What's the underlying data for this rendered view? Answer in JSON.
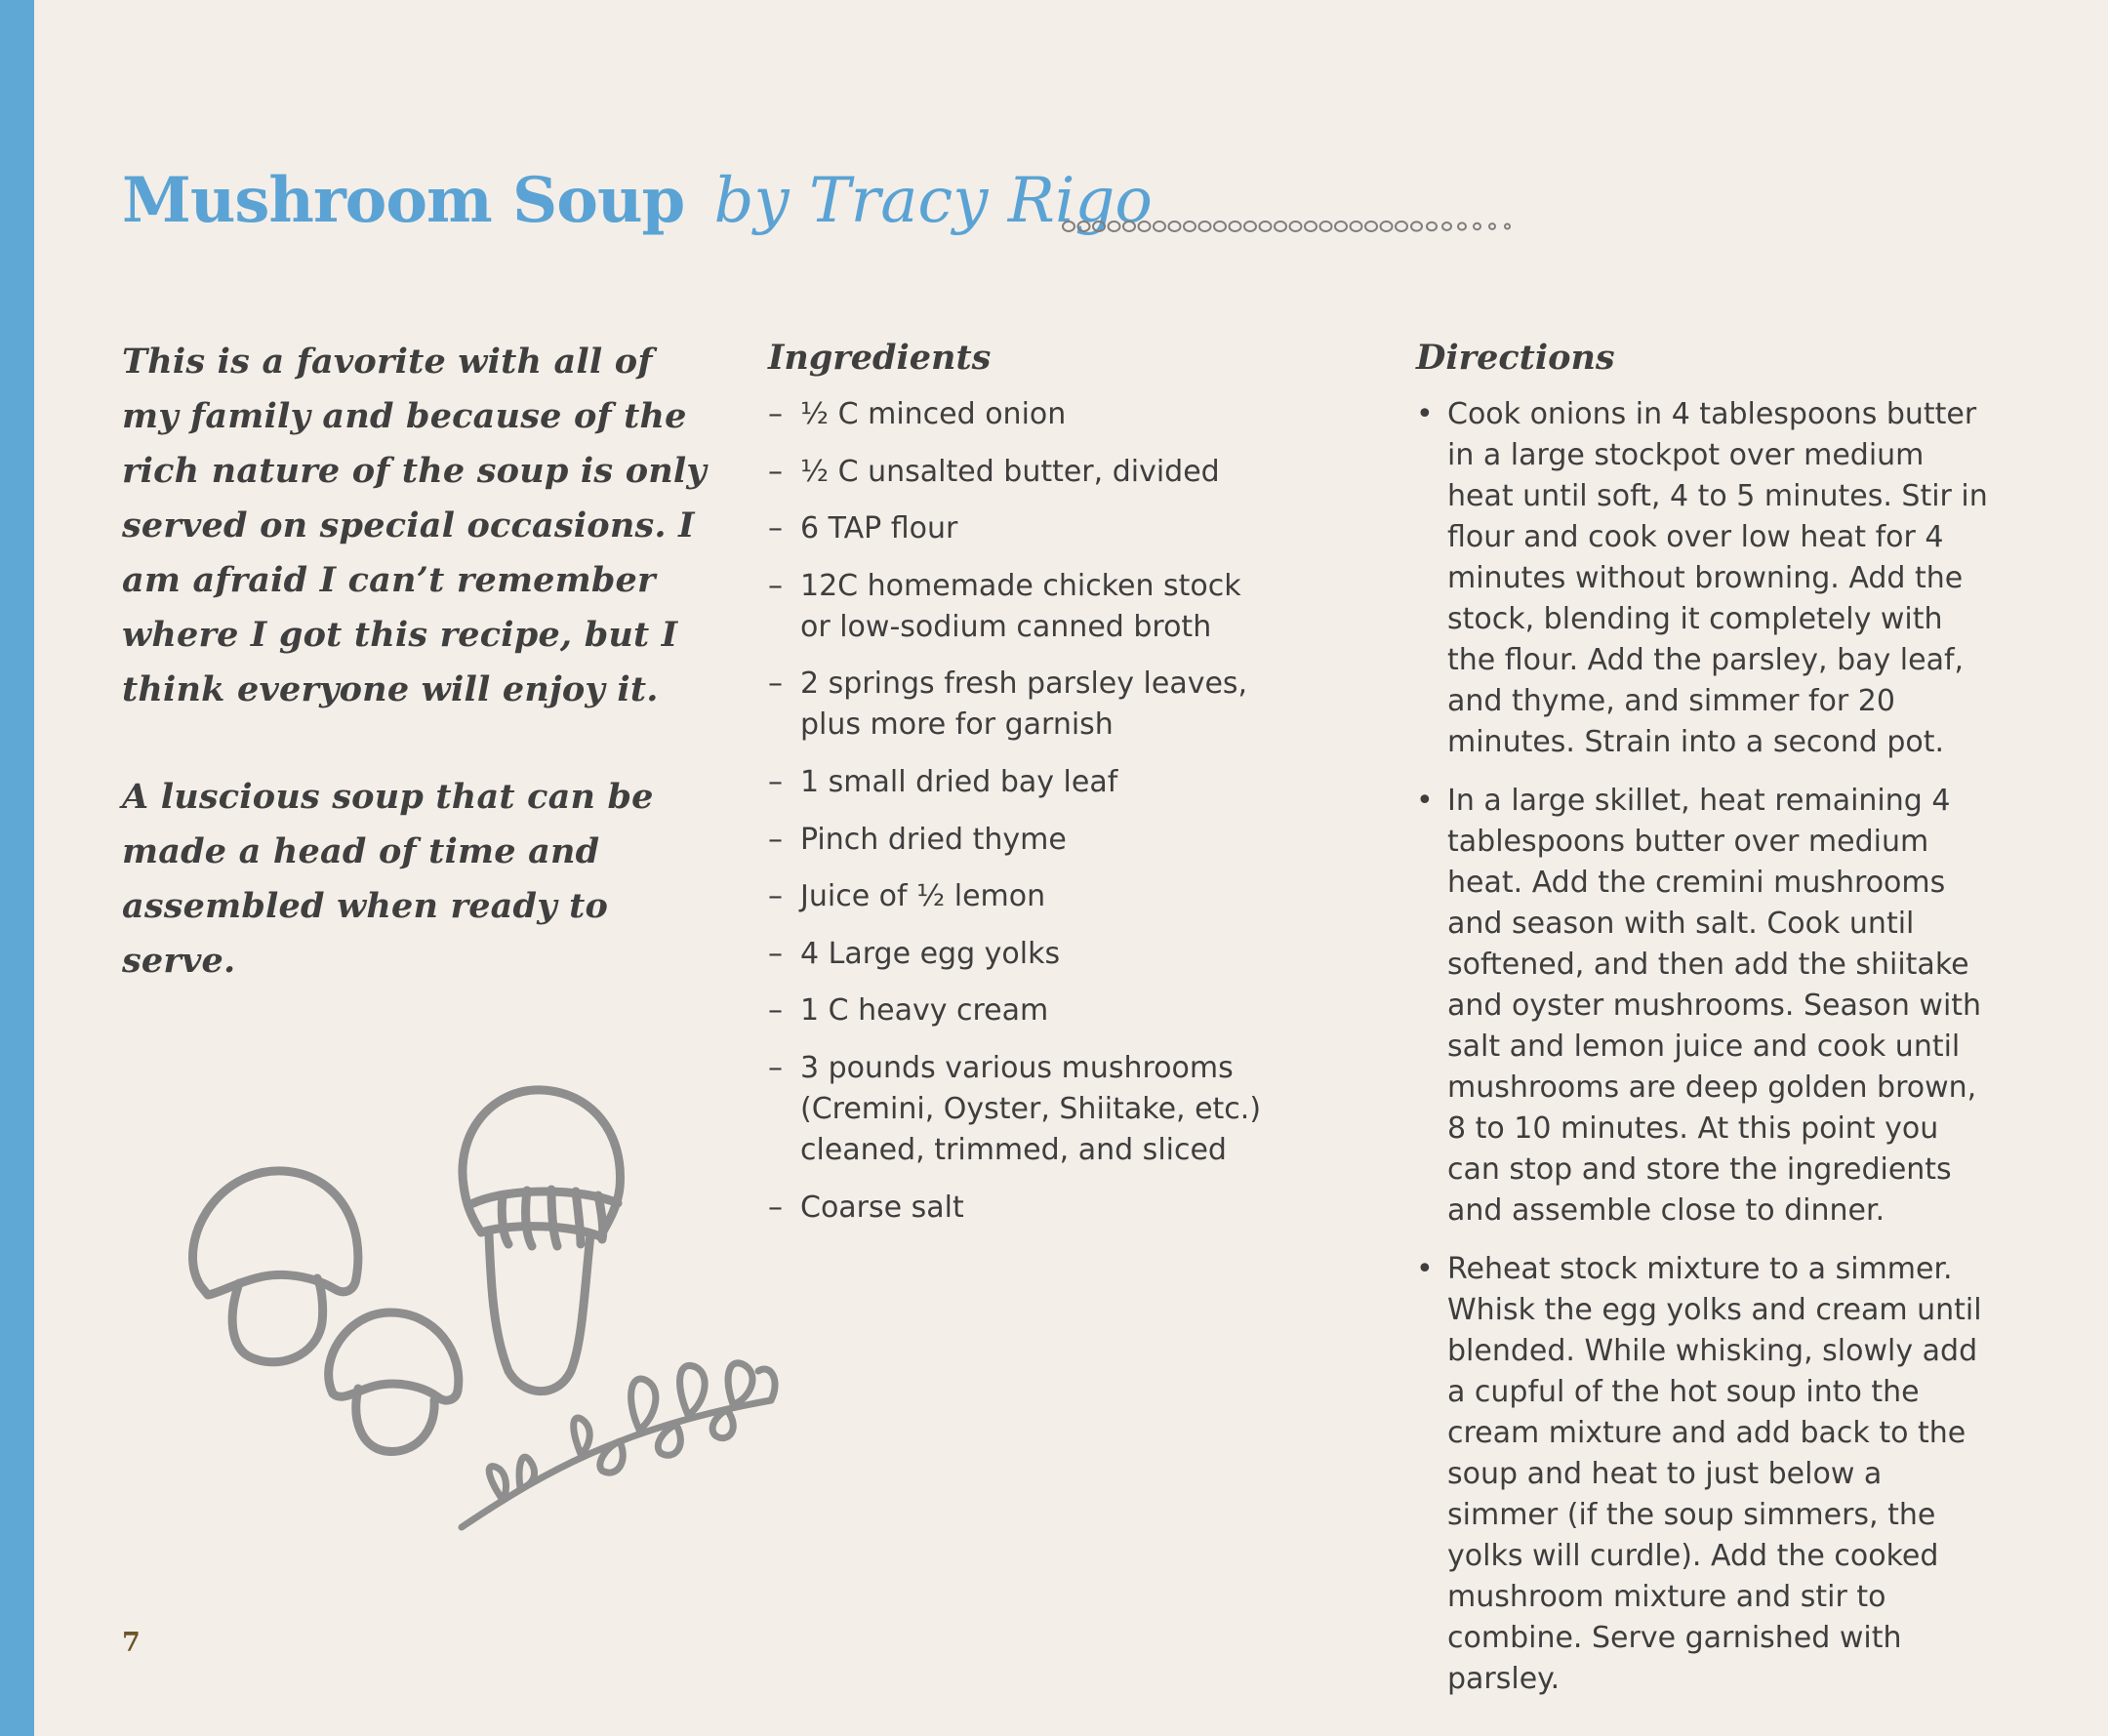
{
  "colors": {
    "accent_blue": "#5aa3d4",
    "sidebar_blue": "#5fa8d6",
    "background": "#f4eee8",
    "text": "#3e3e3e",
    "illustration_gray": "#8e8e8e",
    "page_number": "#6b5528"
  },
  "title": {
    "main": "Mushroom Soup",
    "byline": "by Tracy Rigo"
  },
  "intro": {
    "paragraph_1": "This is a favorite with all of my family and because of the rich nature of the soup is only served on special occasions. I am afraid I can’t remember where I got this recipe, but I think everyone will enjoy it.",
    "paragraph_2": "A luscious soup that can be made a head of time and assembled when ready to serve."
  },
  "ingredients": {
    "heading": "Ingredients",
    "marker": "–",
    "items": [
      "½ C minced onion",
      "½ C unsalted butter, divided",
      "6 TAP flour",
      "12C homemade chicken stock or low-sodium canned broth",
      "2 springs fresh parsley leaves, plus more for garnish",
      "1 small dried bay leaf",
      "Pinch dried thyme",
      "Juice of ½ lemon",
      "4 Large egg yolks",
      "1 C heavy cream",
      "3 pounds various mushrooms (Cremini, Oyster, Shiitake, etc.) cleaned, trimmed, and sliced",
      "Coarse salt"
    ]
  },
  "directions": {
    "heading": "Directions",
    "marker": "•",
    "steps": [
      "Cook onions in 4 tablespoons butter in a large stockpot over medium heat until soft, 4 to 5 minutes. Stir in flour and cook over low heat for 4 minutes without browning. Add the stock, blending it completely with the flour. Add the parsley, bay leaf, and thyme, and simmer for 20 minutes. Strain into a second pot.",
      "In a large skillet, heat remaining 4 tablespoons butter over medium heat. Add the cremini mushrooms and season with salt. Cook until softened, and then add the shiitake and oyster mushrooms. Season with salt and lemon juice and cook until mushrooms are deep golden brown, 8 to 10 minutes. At this point you can stop and store the ingredients and assemble close to dinner.",
      "Reheat stock mixture to a simmer. Whisk the egg yolks and cream until blended. While whisking, slowly add a cupful of the hot soup into the cream mixture and add back to the soup and heat to just below a simmer (if the soup simmers, the yolks will curdle). Add the cooked mushroom mixture and stir to combine. Serve garnished with parsley."
    ]
  },
  "decorations": {
    "illustration_icon": "mushrooms-and-herb-sprig-icon",
    "divider_icon": "dotted-chain-divider-icon"
  },
  "page_number": "7"
}
